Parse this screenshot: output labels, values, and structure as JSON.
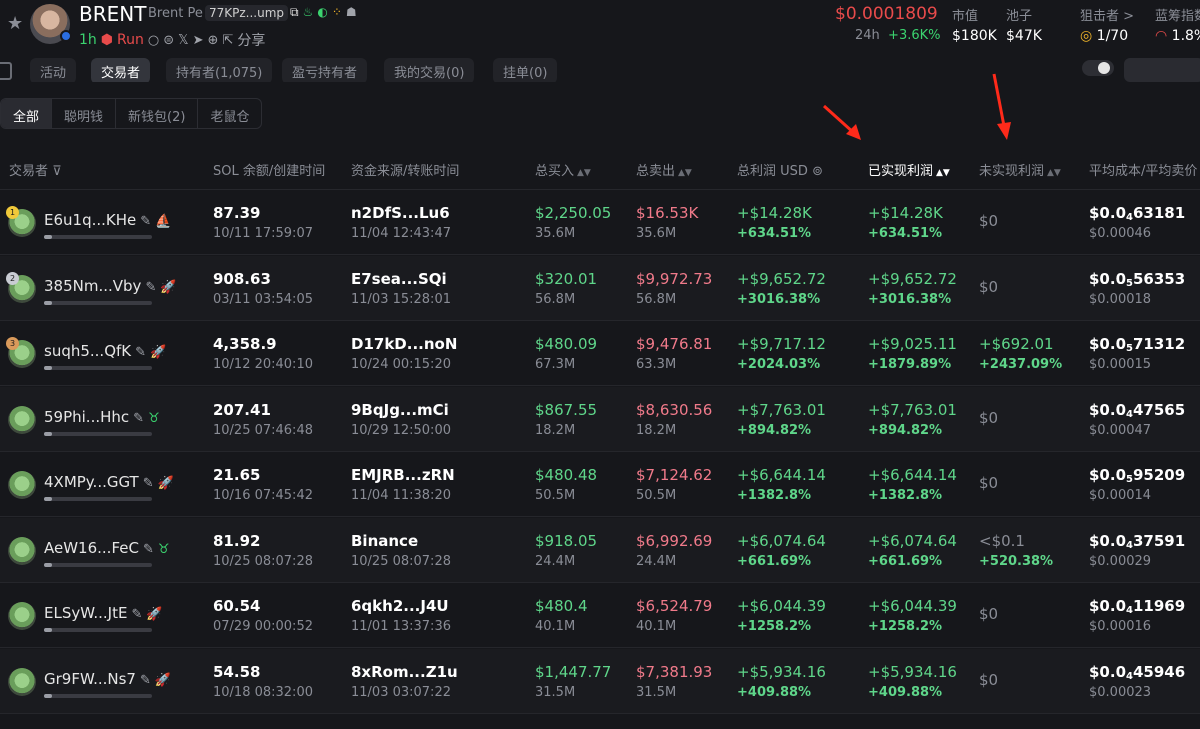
{
  "header": {
    "name": "BRENT",
    "subname": "Brent Pe",
    "address": "77KPz...ump",
    "age": "1h",
    "run": "Run",
    "share": "分享",
    "price": "$0.0001809",
    "change_label": "24h",
    "change": "+3.6K%",
    "stats": [
      {
        "label": "市值",
        "value": "$180K"
      },
      {
        "label": "池子",
        "value": "$47K"
      },
      {
        "label": "狙击者 >",
        "value": "1/70"
      },
      {
        "label": "蓝筹指数",
        "value": "1.8%"
      }
    ]
  },
  "main_tabs": [
    "活动",
    "交易者",
    "持有者(1,075)",
    "盈亏持有者",
    "我的交易(0)",
    "挂单(0)"
  ],
  "filters": [
    "全部",
    "聪明钱",
    "新钱包(2)",
    "老鼠仓"
  ],
  "columns": [
    "交易者",
    "SOL 余额/创建时间",
    "资金来源/转账时间",
    "总买入",
    "总卖出",
    "总利润 USD",
    "已实现利润",
    "未实现利润",
    "平均成本/平均卖价"
  ],
  "rows": [
    {
      "trader": "E6u1q...KHe",
      "rank": "1",
      "sol": "87.39",
      "created": "10/11 17:59:07",
      "source": "n2DfS...Lu6",
      "transfer": "11/04 12:43:47",
      "buy": "$2,250.05",
      "buy_amt": "35.6M",
      "sell": "$16.53K",
      "sell_amt": "35.6M",
      "profit": "+$14.28K",
      "profit_pct": "+634.51%",
      "realized": "+$14.28K",
      "realized_pct": "+634.51%",
      "unrealized": "$0",
      "unrealized_pct": "",
      "avg_prefix": "$0.0",
      "avg_sub": "4",
      "avg_rest": "63181",
      "avg_sell": "$0.00046"
    },
    {
      "trader": "385Nm...Vby",
      "rank": "2",
      "sol": "908.63",
      "created": "03/11 03:54:05",
      "source": "E7sea...SQi",
      "transfer": "11/03 15:28:01",
      "buy": "$320.01",
      "buy_amt": "56.8M",
      "sell": "$9,972.73",
      "sell_amt": "56.8M",
      "profit": "+$9,652.72",
      "profit_pct": "+3016.38%",
      "realized": "+$9,652.72",
      "realized_pct": "+3016.38%",
      "unrealized": "$0",
      "unrealized_pct": "",
      "avg_prefix": "$0.0",
      "avg_sub": "5",
      "avg_rest": "56353",
      "avg_sell": "$0.00018"
    },
    {
      "trader": "suqh5...QfK",
      "rank": "3",
      "sol": "4,358.9",
      "created": "10/12 20:40:10",
      "source": "D17kD...noN",
      "transfer": "10/24 00:15:20",
      "buy": "$480.09",
      "buy_amt": "67.3M",
      "sell": "$9,476.81",
      "sell_amt": "63.3M",
      "profit": "+$9,717.12",
      "profit_pct": "+2024.03%",
      "realized": "+$9,025.11",
      "realized_pct": "+1879.89%",
      "unrealized": "+$692.01",
      "unrealized_pct": "+2437.09%",
      "avg_prefix": "$0.0",
      "avg_sub": "5",
      "avg_rest": "71312",
      "avg_sell": "$0.00015"
    },
    {
      "trader": "59Phi...Hhc",
      "rank": "",
      "sol": "207.41",
      "created": "10/25 07:46:48",
      "source": "9BqJg...mCi",
      "transfer": "10/29 12:50:00",
      "buy": "$867.55",
      "buy_amt": "18.2M",
      "sell": "$8,630.56",
      "sell_amt": "18.2M",
      "profit": "+$7,763.01",
      "profit_pct": "+894.82%",
      "realized": "+$7,763.01",
      "realized_pct": "+894.82%",
      "unrealized": "$0",
      "unrealized_pct": "",
      "avg_prefix": "$0.0",
      "avg_sub": "4",
      "avg_rest": "47565",
      "avg_sell": "$0.00047"
    },
    {
      "trader": "4XMPy...GGT",
      "rank": "",
      "sol": "21.65",
      "created": "10/16 07:45:42",
      "source": "EMJRB...zRN",
      "transfer": "11/04 11:38:20",
      "buy": "$480.48",
      "buy_amt": "50.5M",
      "sell": "$7,124.62",
      "sell_amt": "50.5M",
      "profit": "+$6,644.14",
      "profit_pct": "+1382.8%",
      "realized": "+$6,644.14",
      "realized_pct": "+1382.8%",
      "unrealized": "$0",
      "unrealized_pct": "",
      "avg_prefix": "$0.0",
      "avg_sub": "5",
      "avg_rest": "95209",
      "avg_sell": "$0.00014"
    },
    {
      "trader": "AeW16...FeC",
      "rank": "",
      "sol": "81.92",
      "created": "10/25 08:07:28",
      "source": "Binance",
      "transfer": "10/25 08:07:28",
      "buy": "$918.05",
      "buy_amt": "24.4M",
      "sell": "$6,992.69",
      "sell_amt": "24.4M",
      "profit": "+$6,074.64",
      "profit_pct": "+661.69%",
      "realized": "+$6,074.64",
      "realized_pct": "+661.69%",
      "unrealized": "<$0.1",
      "unrealized_pct": "+520.38%",
      "avg_prefix": "$0.0",
      "avg_sub": "4",
      "avg_rest": "37591",
      "avg_sell": "$0.00029"
    },
    {
      "trader": "ELSyW...JtE",
      "rank": "",
      "sol": "60.54",
      "created": "07/29 00:00:52",
      "source": "6qkh2...J4U",
      "transfer": "11/01 13:37:36",
      "buy": "$480.4",
      "buy_amt": "40.1M",
      "sell": "$6,524.79",
      "sell_amt": "40.1M",
      "profit": "+$6,044.39",
      "profit_pct": "+1258.2%",
      "realized": "+$6,044.39",
      "realized_pct": "+1258.2%",
      "unrealized": "$0",
      "unrealized_pct": "",
      "avg_prefix": "$0.0",
      "avg_sub": "4",
      "avg_rest": "11969",
      "avg_sell": "$0.00016"
    },
    {
      "trader": "Gr9FW...Ns7",
      "rank": "",
      "sol": "54.58",
      "created": "10/18 08:32:00",
      "source": "8xRom...Z1u",
      "transfer": "11/03 03:07:22",
      "buy": "$1,447.77",
      "buy_amt": "31.5M",
      "sell": "$7,381.93",
      "sell_amt": "31.5M",
      "profit": "+$5,934.16",
      "profit_pct": "+409.88%",
      "realized": "+$5,934.16",
      "realized_pct": "+409.88%",
      "unrealized": "$0",
      "unrealized_pct": "",
      "avg_prefix": "$0.0",
      "avg_sub": "4",
      "avg_rest": "45946",
      "avg_sell": "$0.00023"
    }
  ],
  "colors": {
    "green": "#5fd68a",
    "red": "#f07a8a",
    "price_red": "#e84b4b",
    "arrow": "#ff2a1a"
  }
}
